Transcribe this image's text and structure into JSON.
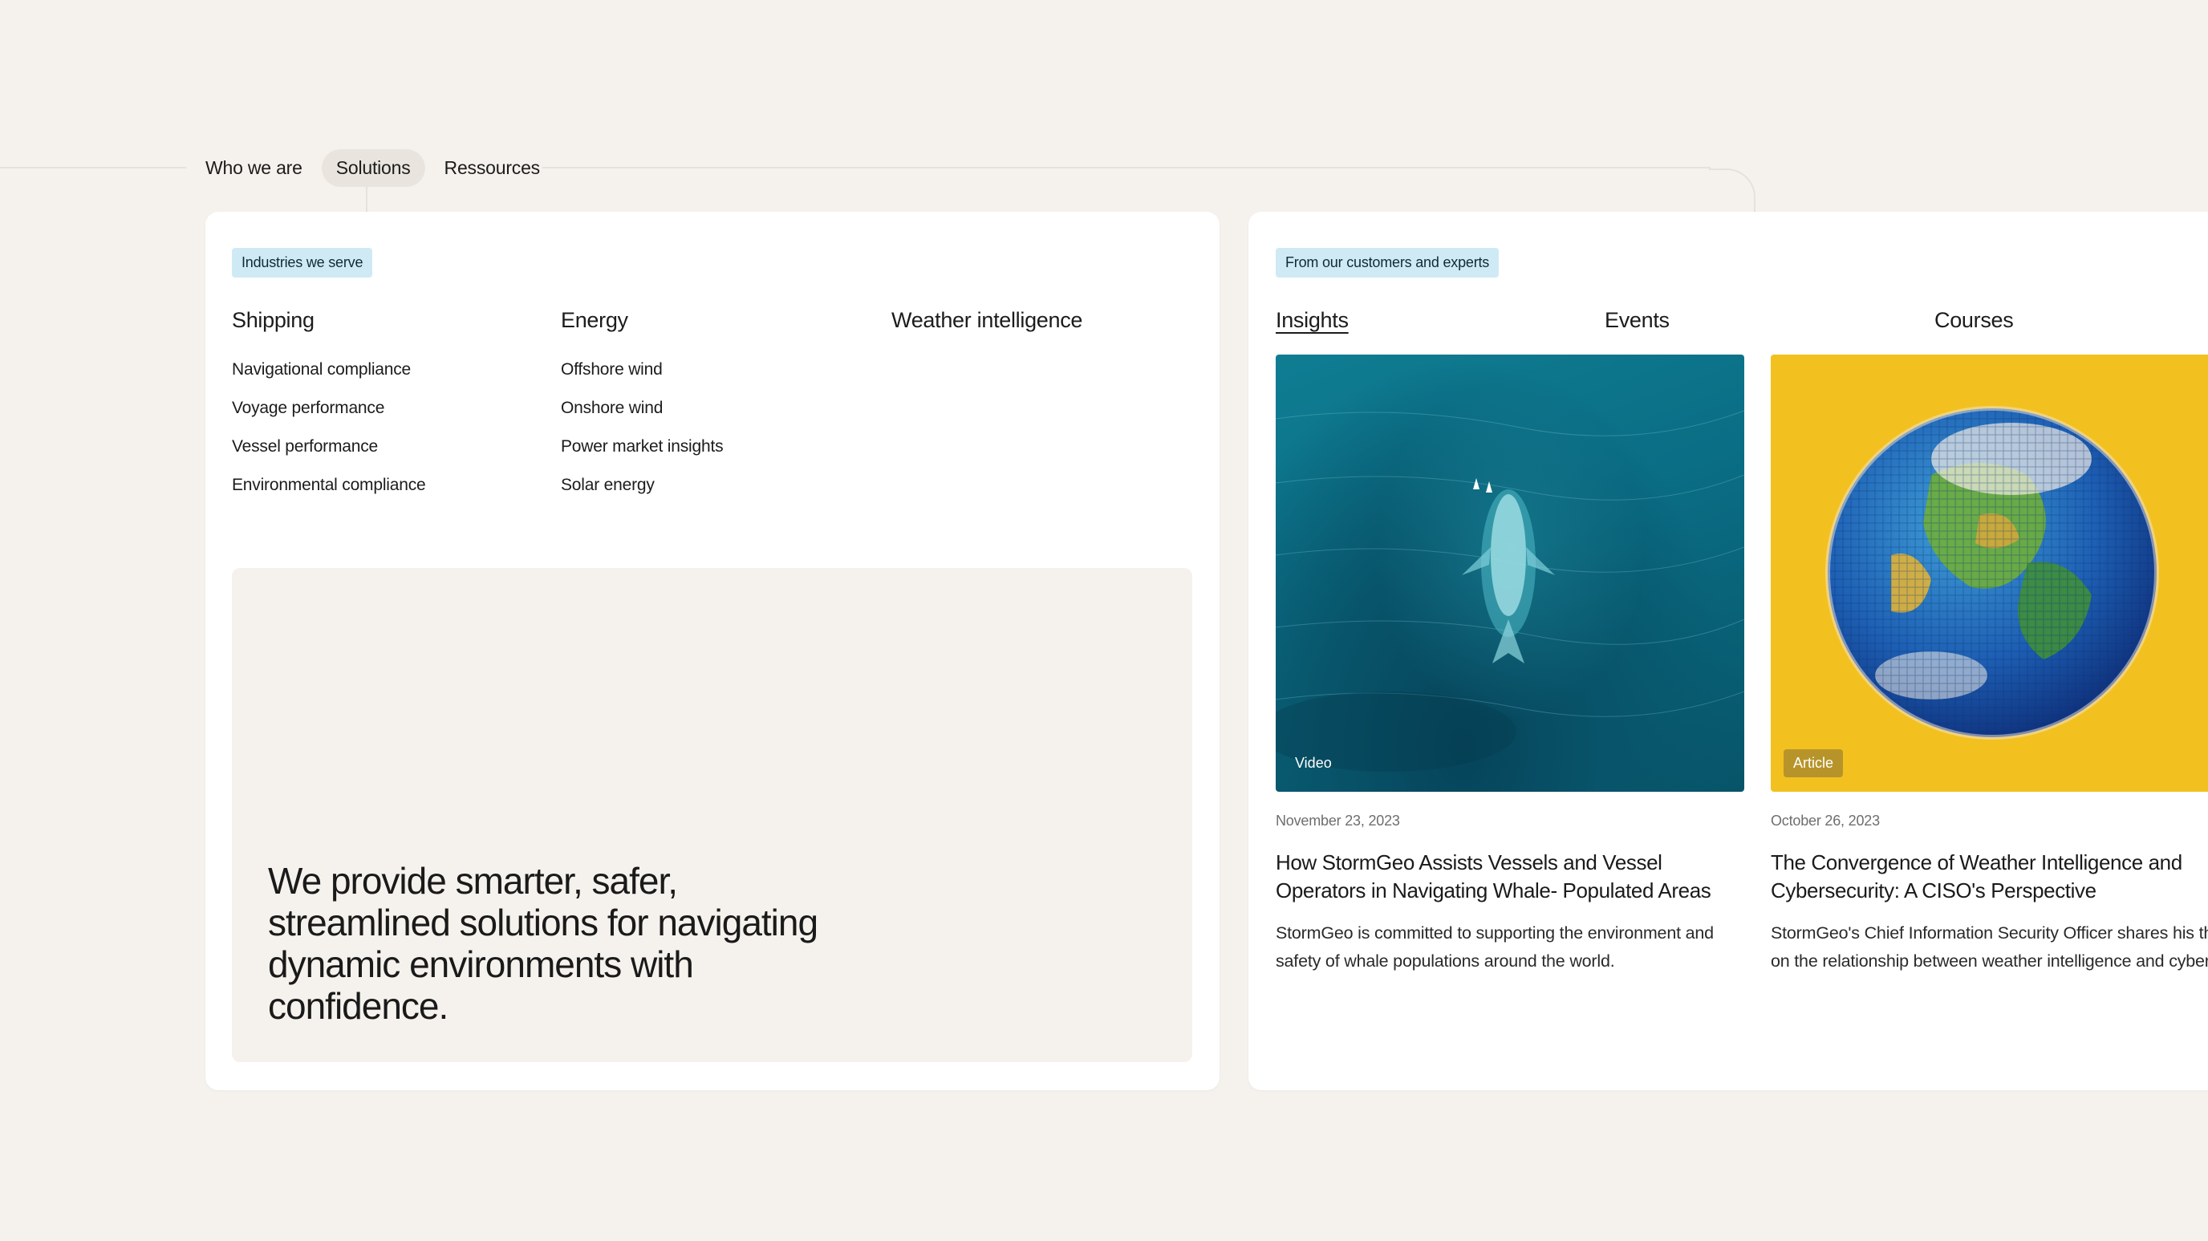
{
  "nav": {
    "items": [
      {
        "label": "Who we are"
      },
      {
        "label": "Solutions",
        "active": true
      },
      {
        "label": "Ressources"
      }
    ]
  },
  "industries": {
    "tag": "Industries we serve",
    "columns": [
      {
        "title": "Shipping",
        "links": [
          "Navigational compliance",
          "Voyage performance",
          "Vessel performance",
          "Environmental compliance"
        ]
      },
      {
        "title": "Energy",
        "links": [
          "Offshore wind",
          "Onshore wind",
          "Power market insights",
          "Solar energy"
        ]
      },
      {
        "title": "Weather intelligence",
        "links": []
      }
    ],
    "hero_text": "We provide smarter, safer, streamlined solutions for navigating dynamic environments with confidence."
  },
  "resources": {
    "tag": "From our customers and experts",
    "tabs": [
      {
        "label": "Insights",
        "active": true
      },
      {
        "label": "Events"
      },
      {
        "label": "Courses"
      }
    ],
    "cards": [
      {
        "image_icon": "whale-aerial-photo",
        "badge": "Video",
        "date": "November 23, 2023",
        "title": "How StormGeo Assists Vessels and Vessel Operators in Navigating Whale- Populated Areas",
        "description": "StormGeo is committed to supporting the environment and safety of whale populations around the world."
      },
      {
        "image_icon": "voxel-globe-illustration",
        "badge": "Article",
        "date": "October 26, 2023",
        "title": "The Convergence of Weather Intelligence and Cybersecurity: A CISO's Perspective",
        "description": "StormGeo's Chief Information Security Officer shares his thoughts on the relationship between weather intelligence and cybersecurity."
      }
    ]
  },
  "colors": {
    "page_bg": "#f5f2ed",
    "panel_bg": "#ffffff",
    "tag_bg": "#cfeaf5",
    "nav_active_bg": "#e9e5de",
    "article_yellow": "#f2c11f",
    "article_badge": "#b7942a"
  }
}
